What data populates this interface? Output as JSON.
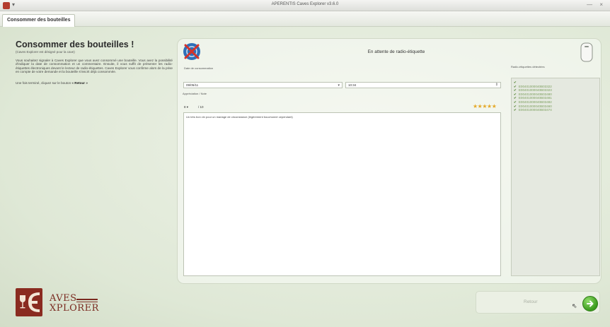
{
  "window": {
    "title": "APERENTIS Caves Explorer v3.6.0",
    "controls": "— ×"
  },
  "tabs": [
    {
      "label": "Consommer des bouteilles"
    }
  ],
  "info": {
    "heading": "Consommer des bouteilles !",
    "subtitle": "(Caves Explorer est désigné pour la cave)",
    "description": "Vous souhaitez signaler à Caves Explorer que vous avez consommé une bouteille. Vous avez la possibilité d'indiquer la date de consommation et un commentaire. Ensuite, il vous suffit de présenter les radio-étiquettes électroniques devant le lecteur de radio-étiquettes. Caves Explorer vous confirme alors de la prise en compte de votre demande et la bouteille s'inscrit déjà consommée.",
    "hint_prefix": "Une fois terminé, cliquez sur le bouton ",
    "hint_button": "« Retour »"
  },
  "logo": {
    "line1": "AVES",
    "line2": "XPLORER"
  },
  "form": {
    "status": "En attente de radio-étiquette",
    "date_label": "Date de consommation",
    "date_value": "09/05/11",
    "time_value": "10:34",
    "appreciation_label": "Appréciation / Note",
    "note_value": "8",
    "note_scale": "/ 10",
    "stars": "★★★★★",
    "comment": "Un très bon vin pour un mariage de circonstance (légèrement bouchonné cependant)"
  },
  "tags": {
    "label": "Radio-étiquettes détectées",
    "items": [
      "E00401000040B03322",
      "E00401000040B03323",
      "E00401000040B03480",
      "E00401000040B03481",
      "E00401000040B03482",
      "E00401000040B03460",
      "E00401000040B03474"
    ]
  },
  "footer": {
    "retour_label": "Retour",
    "validate_icon": "arrow-right-icon"
  },
  "colors": {
    "accent_green": "#3b9b1e",
    "logo_red": "#8a2b20",
    "star": "#e5a92a",
    "tag_text": "#7ea060"
  }
}
